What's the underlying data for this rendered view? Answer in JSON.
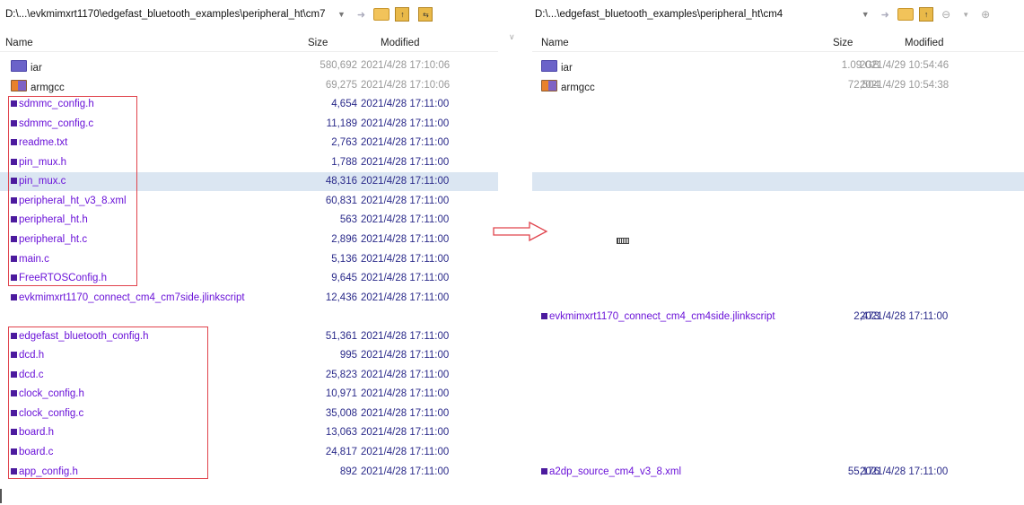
{
  "left": {
    "path": "D:\\...\\evkmimxrt1170\\edgefast_bluetooth_examples\\peripheral_ht\\cm7",
    "columns": {
      "name": "Name",
      "size": "Size",
      "modified": "Modified"
    },
    "rows": [
      {
        "name": "iar",
        "size": "580,692",
        "modified": "2021/4/28 17:10:06",
        "type": "folder-blue",
        "muted": true
      },
      {
        "name": "armgcc",
        "size": "69,275",
        "modified": "2021/4/28 17:10:06",
        "type": "folder-orange",
        "muted": true
      },
      {
        "name": "sdmmc_config.h",
        "size": "4,654",
        "modified": "2021/4/28 17:11:00",
        "type": "file"
      },
      {
        "name": "sdmmc_config.c",
        "size": "11,189",
        "modified": "2021/4/28 17:11:00",
        "type": "file"
      },
      {
        "name": "readme.txt",
        "size": "2,763",
        "modified": "2021/4/28 17:11:00",
        "type": "file"
      },
      {
        "name": "pin_mux.h",
        "size": "1,788",
        "modified": "2021/4/28 17:11:00",
        "type": "file"
      },
      {
        "name": "pin_mux.c",
        "size": "48,316",
        "modified": "2021/4/28 17:11:00",
        "type": "file",
        "selected": true
      },
      {
        "name": "peripheral_ht_v3_8.xml",
        "size": "60,831",
        "modified": "2021/4/28 17:11:00",
        "type": "file"
      },
      {
        "name": "peripheral_ht.h",
        "size": "563",
        "modified": "2021/4/28 17:11:00",
        "type": "file"
      },
      {
        "name": "peripheral_ht.c",
        "size": "2,896",
        "modified": "2021/4/28 17:11:00",
        "type": "file"
      },
      {
        "name": "main.c",
        "size": "5,136",
        "modified": "2021/4/28 17:11:00",
        "type": "file"
      },
      {
        "name": "FreeRTOSConfig.h",
        "size": "9,645",
        "modified": "2021/4/28 17:11:00",
        "type": "file"
      },
      {
        "name": "evkmimxrt1170_connect_cm4_cm7side.jlinkscript",
        "size": "12,436",
        "modified": "2021/4/28 17:11:00",
        "type": "file"
      },
      {
        "name": "",
        "size": "",
        "modified": "",
        "type": "empty"
      },
      {
        "name": "edgefast_bluetooth_config.h",
        "size": "51,361",
        "modified": "2021/4/28 17:11:00",
        "type": "file"
      },
      {
        "name": "dcd.h",
        "size": "995",
        "modified": "2021/4/28 17:11:00",
        "type": "file"
      },
      {
        "name": "dcd.c",
        "size": "25,823",
        "modified": "2021/4/28 17:11:00",
        "type": "file"
      },
      {
        "name": "clock_config.h",
        "size": "10,971",
        "modified": "2021/4/28 17:11:00",
        "type": "file"
      },
      {
        "name": "clock_config.c",
        "size": "35,008",
        "modified": "2021/4/28 17:11:00",
        "type": "file"
      },
      {
        "name": "board.h",
        "size": "13,063",
        "modified": "2021/4/28 17:11:00",
        "type": "file"
      },
      {
        "name": "board.c",
        "size": "24,817",
        "modified": "2021/4/28 17:11:00",
        "type": "file"
      },
      {
        "name": "app_config.h",
        "size": "892",
        "modified": "2021/4/28 17:11:00",
        "type": "file"
      }
    ]
  },
  "right": {
    "path": "D:\\...\\edgefast_bluetooth_examples\\peripheral_ht\\cm4",
    "columns": {
      "name": "Name",
      "size": "Size",
      "modified": "Modified"
    },
    "rows": [
      {
        "name": "iar",
        "size": "1.09 GB",
        "modified": "2021/4/29 10:54:46",
        "type": "folder-blue",
        "muted": true
      },
      {
        "name": "armgcc",
        "size": "72,504",
        "modified": "2021/4/29 10:54:38",
        "type": "folder-orange",
        "muted": true
      },
      {
        "name": "",
        "size": "",
        "modified": "",
        "type": "empty"
      },
      {
        "name": "",
        "size": "",
        "modified": "",
        "type": "empty"
      },
      {
        "name": "",
        "size": "",
        "modified": "",
        "type": "empty"
      },
      {
        "name": "",
        "size": "",
        "modified": "",
        "type": "empty"
      },
      {
        "name": "",
        "size": "",
        "modified": "",
        "type": "empty",
        "selected": true
      },
      {
        "name": "",
        "size": "",
        "modified": "",
        "type": "empty"
      },
      {
        "name": "",
        "size": "",
        "modified": "",
        "type": "empty"
      },
      {
        "name": "",
        "size": "",
        "modified": "",
        "type": "empty"
      },
      {
        "name": "",
        "size": "",
        "modified": "",
        "type": "empty"
      },
      {
        "name": "",
        "size": "",
        "modified": "",
        "type": "empty"
      },
      {
        "name": "",
        "size": "",
        "modified": "",
        "type": "empty"
      },
      {
        "name": "evkmimxrt1170_connect_cm4_cm4side.jlinkscript",
        "size": "2,473",
        "modified": "2021/4/28 17:11:00",
        "type": "file"
      },
      {
        "name": "",
        "size": "",
        "modified": "",
        "type": "empty"
      },
      {
        "name": "",
        "size": "",
        "modified": "",
        "type": "empty"
      },
      {
        "name": "",
        "size": "",
        "modified": "",
        "type": "empty"
      },
      {
        "name": "",
        "size": "",
        "modified": "",
        "type": "empty"
      },
      {
        "name": "",
        "size": "",
        "modified": "",
        "type": "empty"
      },
      {
        "name": "",
        "size": "",
        "modified": "",
        "type": "empty"
      },
      {
        "name": "",
        "size": "",
        "modified": "",
        "type": "empty"
      },
      {
        "name": "a2dp_source_cm4_v3_8.xml",
        "size": "55,176",
        "modified": "2021/4/28 17:11:00",
        "type": "file"
      }
    ]
  },
  "colors": {
    "file_text": "#6a12d8",
    "size_text": "#2a2a8a",
    "selection": "#dbe6f2",
    "annotation": "#e0434c"
  },
  "icons": [
    "chevron-down-icon",
    "sync-arrow-icon",
    "folder-icon",
    "parent-folder-icon",
    "swap-panes-icon",
    "back-icon",
    "forward-icon"
  ]
}
